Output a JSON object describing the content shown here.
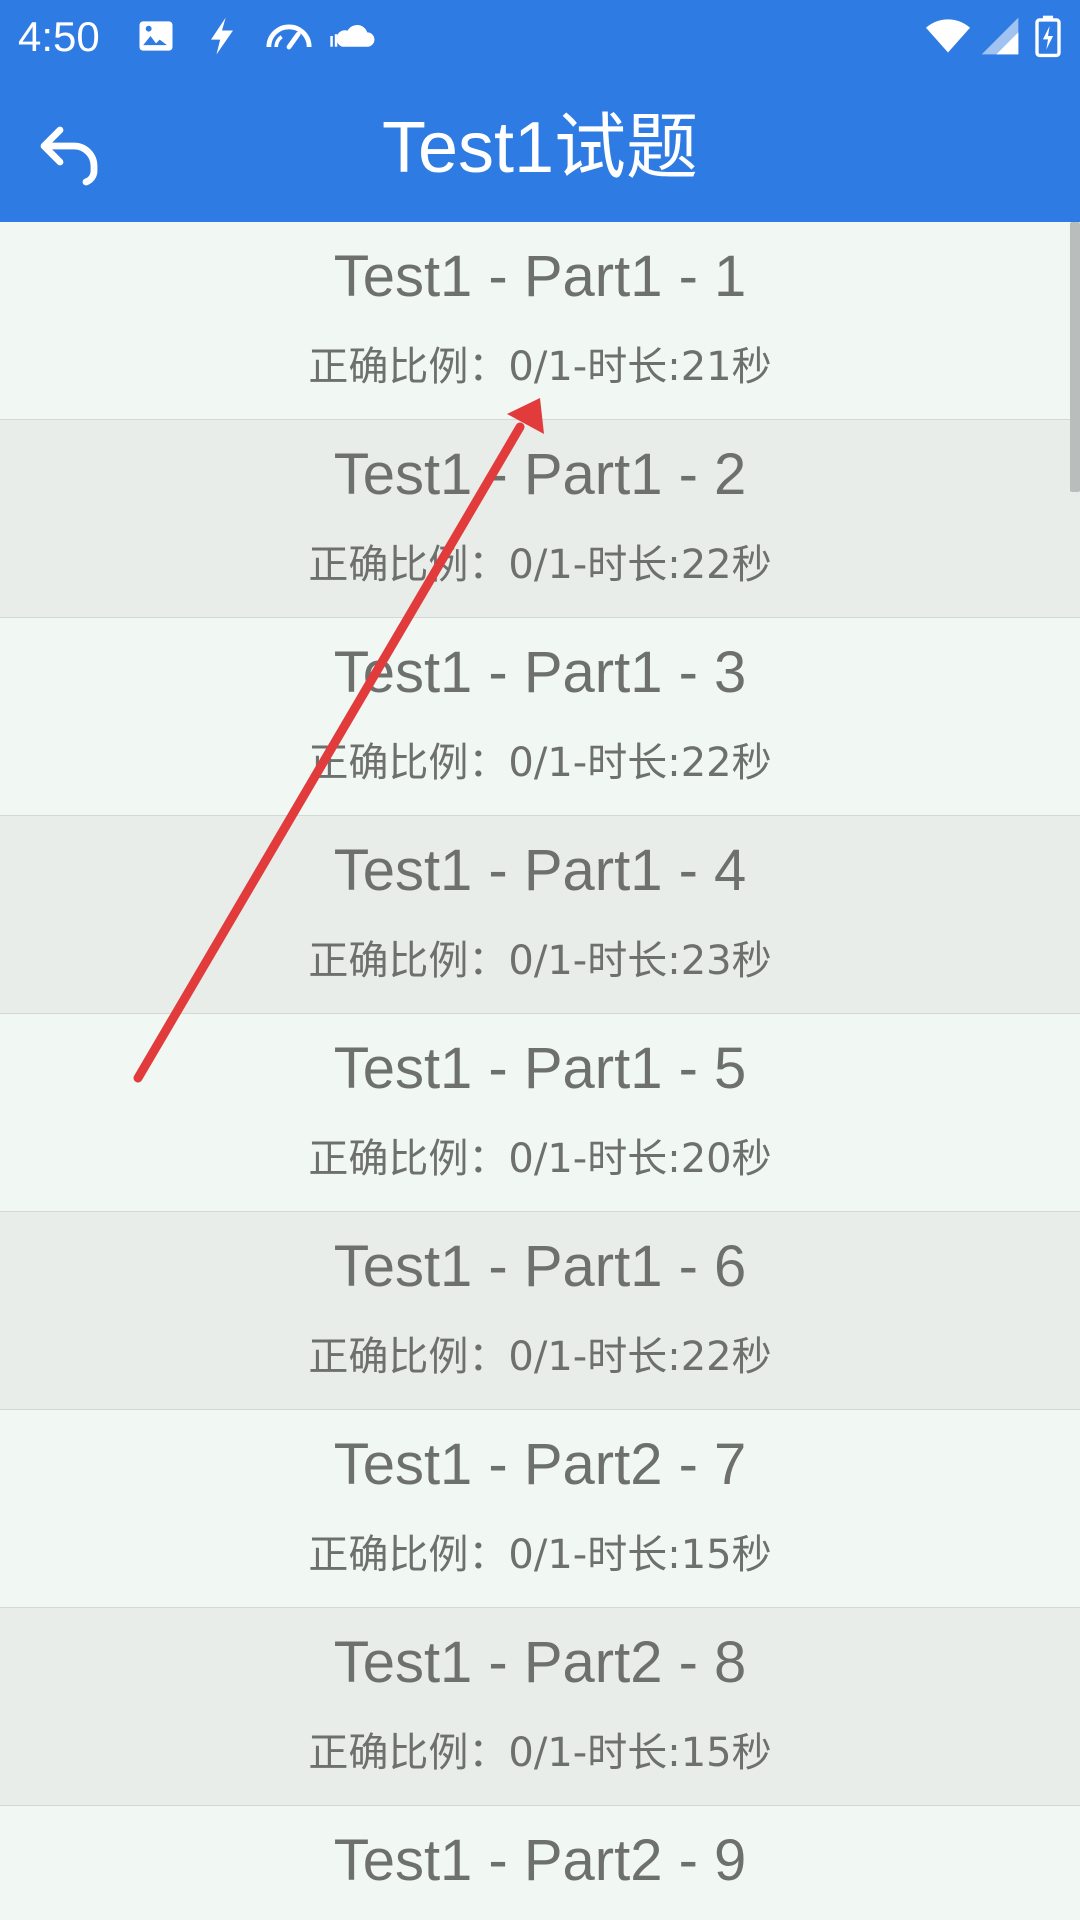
{
  "status_bar": {
    "time": "4:50",
    "icons": [
      "image-icon",
      "flash-icon",
      "speedometer-icon",
      "cloud-icon",
      "wifi-icon",
      "signal-icon",
      "battery-charging-icon"
    ]
  },
  "app_bar": {
    "title": "Test1试题",
    "back_icon": "undo-arrow-icon"
  },
  "colors": {
    "primary": "#2e7be3",
    "row_light": "#f1f8f4",
    "row_dark": "#e8ede9",
    "text": "#6e706e",
    "annotation_arrow": "#e23b3b"
  },
  "list": {
    "items": [
      {
        "title": "Test1 - Part1 - 1",
        "subtitle": "正确比例：0/1-时长:21秒"
      },
      {
        "title": "Test1 - Part1 - 2",
        "subtitle": "正确比例：0/1-时长:22秒"
      },
      {
        "title": "Test1 - Part1 - 3",
        "subtitle": "正确比例：0/1-时长:22秒"
      },
      {
        "title": "Test1 - Part1 - 4",
        "subtitle": "正确比例：0/1-时长:23秒"
      },
      {
        "title": "Test1 - Part1 - 5",
        "subtitle": "正确比例：0/1-时长:20秒"
      },
      {
        "title": "Test1 - Part1 - 6",
        "subtitle": "正确比例：0/1-时长:22秒"
      },
      {
        "title": "Test1 - Part2 - 7",
        "subtitle": "正确比例：0/1-时长:15秒"
      },
      {
        "title": "Test1 - Part2 - 8",
        "subtitle": "正确比例：0/1-时长:15秒"
      },
      {
        "title": "Test1 - Part2 - 9",
        "subtitle": ""
      }
    ]
  }
}
